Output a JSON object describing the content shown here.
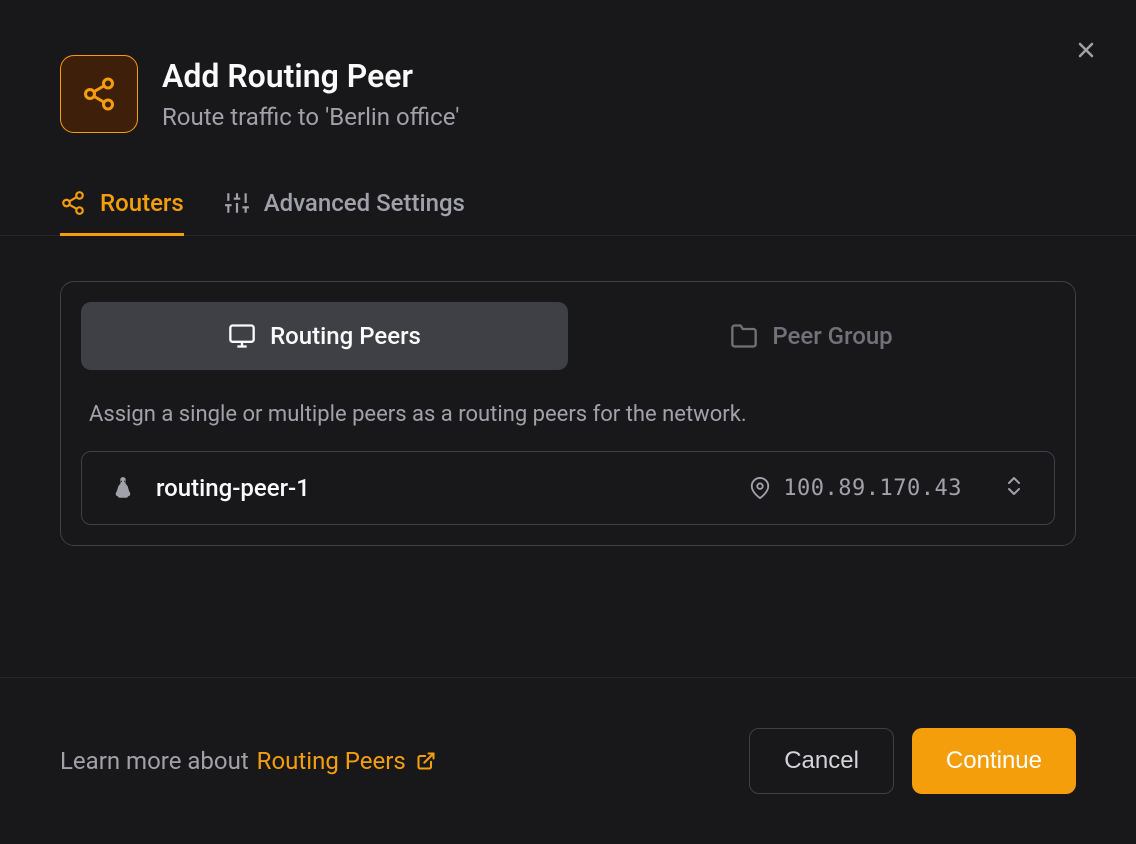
{
  "header": {
    "title": "Add Routing Peer",
    "subtitle": "Route traffic to 'Berlin office'"
  },
  "tabs": [
    {
      "label": "Routers",
      "active": true
    },
    {
      "label": "Advanced Settings",
      "active": false
    }
  ],
  "panel": {
    "toggles": [
      {
        "label": "Routing Peers",
        "active": true
      },
      {
        "label": "Peer Group",
        "active": false
      }
    ],
    "description": "Assign a single or multiple peers as a routing peers for the network.",
    "selected_peer": {
      "name": "routing-peer-1",
      "ip": "100.89.170.43"
    }
  },
  "footer": {
    "learn_prefix": "Learn more about",
    "learn_link": "Routing Peers",
    "cancel": "Cancel",
    "continue": "Continue"
  }
}
